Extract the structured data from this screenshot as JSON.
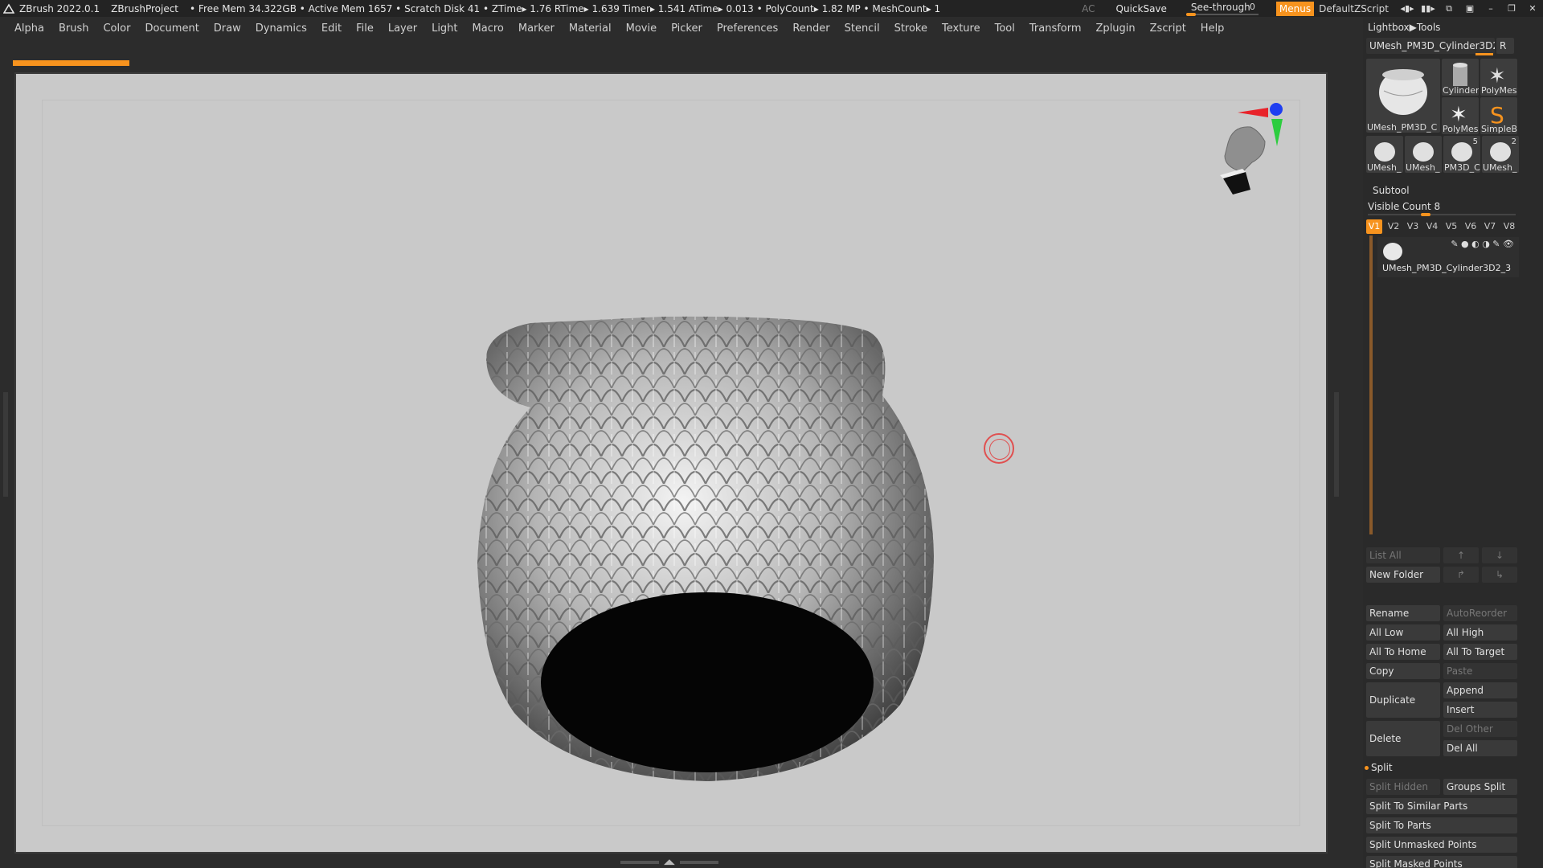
{
  "titlebar": {
    "app_name": "ZBrush 2022.0.1",
    "project": "ZBrushProject",
    "stats": "• Free Mem 34.322GB • Active Mem 1657 • Scratch Disk 41 •  ZTime▸ 1.76 RTime▸ 1.639 Timer▸ 1.541 ATime▸ 0.013 • PolyCount▸ 1.82 MP  • MeshCount▸ 1",
    "ac": "AC",
    "quicksave": "QuickSave",
    "see_through_label": "See-through",
    "see_through_value": "0",
    "see_through_level": 0,
    "menus": "Menus",
    "script": "DefaultZScript"
  },
  "menubar": [
    "Alpha",
    "Brush",
    "Color",
    "Document",
    "Draw",
    "Dynamics",
    "Edit",
    "File",
    "Layer",
    "Light",
    "Macro",
    "Marker",
    "Material",
    "Movie",
    "Picker",
    "Preferences",
    "Render",
    "Stencil",
    "Stroke",
    "Texture",
    "Tool",
    "Transform",
    "Zplugin",
    "Zscript",
    "Help"
  ],
  "rightpanel": {
    "lightbox_tools": "Lightbox▶Tools",
    "current_tool": "UMesh_PM3D_Cylinder3D2",
    "r_button": "R",
    "tools": [
      {
        "caption": "UMesh_PM3D_C"
      },
      {
        "caption": "Cylinder"
      },
      {
        "caption": "PolyMes"
      },
      {
        "caption": "PolyMes"
      },
      {
        "caption": "SimpleB"
      },
      {
        "caption": "UMesh_"
      },
      {
        "caption": "UMesh_"
      },
      {
        "caption": "PM3D_C"
      },
      {
        "caption": "UMesh_"
      }
    ],
    "tool_badges": [
      "5",
      "2"
    ],
    "subtool_header": "Subtool",
    "visible_count_label": "Visible Count 8",
    "visible_count": 8,
    "visible_count_max": 64,
    "vtabs": [
      "V1",
      "V2",
      "V3",
      "V4",
      "V5",
      "V6",
      "V7",
      "V8"
    ],
    "subtool_name": "UMesh_PM3D_Cylinder3D2_3",
    "list_all": "List All",
    "new_folder": "New Folder",
    "rename": "Rename",
    "autoreorder": "AutoReorder",
    "all_low": "All Low",
    "all_high": "All High",
    "all_to_home": "All To Home",
    "all_to_target": "All To Target",
    "copy": "Copy",
    "paste": "Paste",
    "duplicate": "Duplicate",
    "append": "Append",
    "insert": "Insert",
    "delete": "Delete",
    "del_other": "Del Other",
    "del_all": "Del All",
    "split_header": "Split",
    "split_hidden": "Split Hidden",
    "groups_split": "Groups Split",
    "split_similar": "Split To Similar Parts",
    "split_parts": "Split To Parts",
    "split_unmasked": "Split Unmasked Points",
    "split_masked": "Split Masked Points"
  }
}
